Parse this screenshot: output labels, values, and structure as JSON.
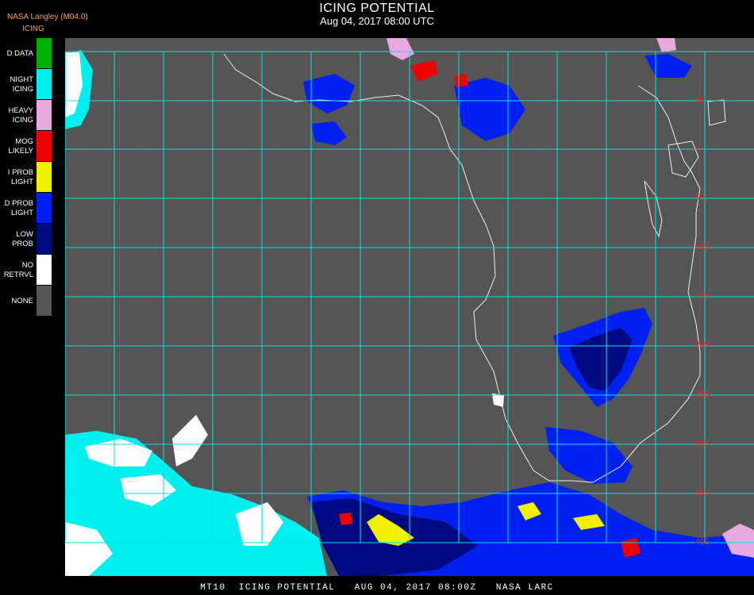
{
  "header": {
    "agency": "NASA Langley (M04.0)",
    "title": "ICING POTENTIAL",
    "subtitle": "Aug 04, 2017 08:00 UTC"
  },
  "legend": {
    "title": "ICING",
    "items": [
      {
        "label": "D DATA",
        "color": "#00b000"
      },
      {
        "label": "NIGHT\nICING",
        "color": "#00f0f0"
      },
      {
        "label": "HEAVY\nICING",
        "color": "#e8a8e0"
      },
      {
        "label": "MOG\nLIKELY",
        "color": "#f00000"
      },
      {
        "label": "I PROB\nLIGHT",
        "color": "#f0f000"
      },
      {
        "label": "D PROB\nLIGHT",
        "color": "#0020f0"
      },
      {
        "label": "LOW\nPROB",
        "color": "#000a80"
      },
      {
        "label": "NO\nRETRVL",
        "color": "#ffffff"
      },
      {
        "label": "NONE",
        "color": "#555555"
      }
    ]
  },
  "map": {
    "background_color": "#555555",
    "grid_color": "#00e5e5",
    "coastline_color": "#f0f0f0",
    "grid_label_color": "#e02828",
    "lat_labels": [
      "5N",
      "0",
      "5S",
      "10S",
      "15S",
      "20S",
      "25S",
      "30S",
      "35S",
      "40S"
    ]
  },
  "footer": {
    "text": "MT10  ICING POTENTIAL   AUG 04, 2017 08:00Z   NASA LARC"
  }
}
